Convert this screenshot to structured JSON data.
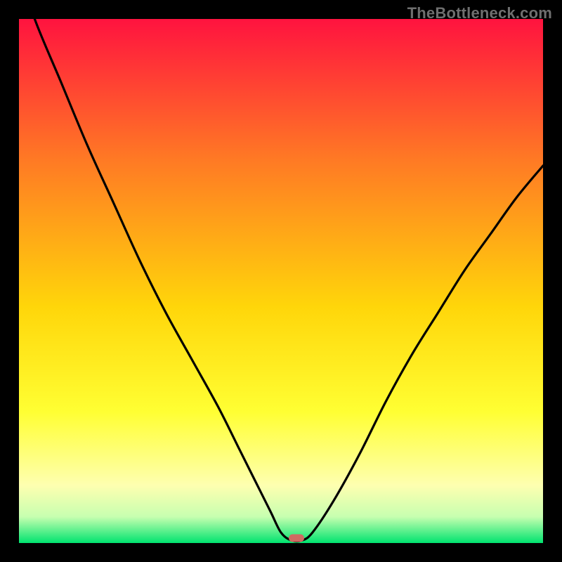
{
  "watermark": {
    "text": "TheBottleneck.com"
  },
  "colors": {
    "gradient_top": "#ff133f",
    "gradient_mid1": "#ff7a24",
    "gradient_mid2": "#ffd60a",
    "gradient_yellow": "#ffff33",
    "gradient_lightyellow": "#feffb0",
    "gradient_pale": "#c7ffb0",
    "gradient_green": "#00e36f",
    "curve": "#000000",
    "marker": "#cf6a62",
    "frame": "#000000"
  },
  "chart_data": {
    "type": "line",
    "title": "",
    "xlabel": "",
    "ylabel": "",
    "xlim": [
      0,
      100
    ],
    "ylim": [
      0,
      100
    ],
    "series": [
      {
        "name": "bottleneck-curve",
        "x": [
          0,
          3,
          8,
          13,
          18,
          23,
          28,
          33,
          38,
          42,
          45,
          48,
          50,
          52,
          54,
          56,
          60,
          65,
          70,
          75,
          80,
          85,
          90,
          95,
          100
        ],
        "y": [
          110,
          100,
          88,
          76,
          65,
          54,
          44,
          35,
          26,
          18,
          12,
          6,
          2,
          0.5,
          0.5,
          2,
          8,
          17,
          27,
          36,
          44,
          52,
          59,
          66,
          72
        ]
      }
    ],
    "annotations": [
      {
        "name": "minimum-marker",
        "x": 53,
        "y": 1
      }
    ]
  }
}
